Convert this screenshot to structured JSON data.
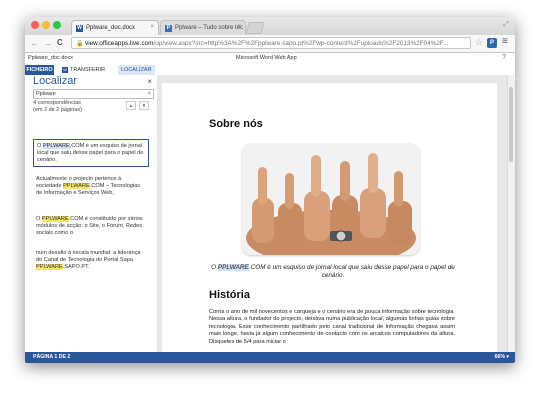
{
  "browser": {
    "tabs": [
      {
        "label": "Pplware_doc.docx",
        "close": "×"
      },
      {
        "label": "Pplware – Tudo sobre tec",
        "close": "×"
      }
    ],
    "url_host": "view.officeapps.live.com",
    "url_rest": "/op/view.aspx?src=http%3A%2F%2Fpplware.sapo.pt%2Fwp-content%2Fuploads%2F2013%2F04%2F...",
    "lock": "🔒",
    "back": "←",
    "forward": "→",
    "reload": "C",
    "star": "☆",
    "ext_label": "P",
    "menu": "≡",
    "maximize": "⤢"
  },
  "app": {
    "doc_name": "Pplware_doc.docx",
    "app_name": "Microsoft Word Web App",
    "help": "?"
  },
  "ribbon": {
    "file": "FICHEIRO",
    "download_icon": "W",
    "download": "TRANSFERIR",
    "find": "LOCALIZAR"
  },
  "find": {
    "title": "Localizar",
    "close": "×",
    "query": "Pplware",
    "clear": "×",
    "count_line1": "4 correspondências",
    "count_line2": "(em 2 de 2 páginas)",
    "up": "▲",
    "down": "▼",
    "results": [
      {
        "pre": "O ",
        "hit": "PPLWARE",
        "post": ".COM é um esquiso de jornal local que saiu desse papel para o papel de cenário."
      },
      {
        "pre": "Actualmente o projecto pertence à sociedade ",
        "hit": "PPLWARE",
        "post": ".COM – Tecnologias de Informação e Serviços Web,"
      },
      {
        "pre": "O ",
        "hit": "PPLWARE",
        "post": ".COM é constituído por vários módulos de acção: o Site, o Fórum, Redes sociais como o"
      },
      {
        "pre": "num desafio à escala mundial: a liderança do Canal de Tecnologia do Portal Sapo. ",
        "hit": "PPLWARE",
        "post": ".SAPO.PT."
      }
    ]
  },
  "document": {
    "heading1": "Sobre nós",
    "caption_pre": "O ",
    "caption_hit": "PPLWARE",
    "caption_post": ".COM é um esquiso de jornal local que saiu desse papel para o papel de cenário.",
    "heading2": "História",
    "body": "Corria o ano de mil novecentos e carqueja e o cenário era de pouca informação sobre tecnologia. Nessa altura, o fundador do projecto, deixava numa publicação local, algumas linhas guias sobre tecnologia. Esse conhecimento partilhado pelo canal tradicional de informação chegava assim mais longe, havia já algum conhecimento de contacto com os arcaicos computadores da altura. Disquetes de 5/4 para iniciar o"
  },
  "status": {
    "page": "PÁGINA 1 DE 2",
    "zoom": "66% ▾"
  },
  "colors": {
    "accent": "#2b579a",
    "highlight": "#f5e66b",
    "traffic_red": "#fc5f57",
    "traffic_yellow": "#fdbc2e",
    "traffic_green": "#28c840"
  }
}
